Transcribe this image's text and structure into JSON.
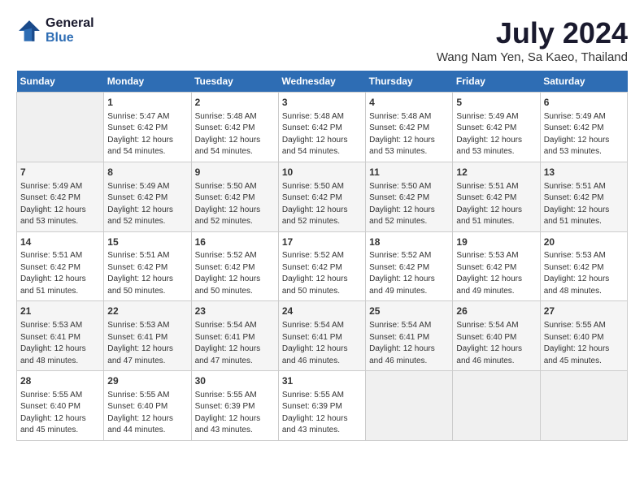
{
  "header": {
    "logo_line1": "General",
    "logo_line2": "Blue",
    "main_title": "July 2024",
    "subtitle": "Wang Nam Yen, Sa Kaeo, Thailand"
  },
  "weekdays": [
    "Sunday",
    "Monday",
    "Tuesday",
    "Wednesday",
    "Thursday",
    "Friday",
    "Saturday"
  ],
  "weeks": [
    [
      {
        "day": "",
        "sunrise": "",
        "sunset": "",
        "daylight": "",
        "empty": true
      },
      {
        "day": "1",
        "sunrise": "Sunrise: 5:47 AM",
        "sunset": "Sunset: 6:42 PM",
        "daylight": "Daylight: 12 hours and 54 minutes."
      },
      {
        "day": "2",
        "sunrise": "Sunrise: 5:48 AM",
        "sunset": "Sunset: 6:42 PM",
        "daylight": "Daylight: 12 hours and 54 minutes."
      },
      {
        "day": "3",
        "sunrise": "Sunrise: 5:48 AM",
        "sunset": "Sunset: 6:42 PM",
        "daylight": "Daylight: 12 hours and 54 minutes."
      },
      {
        "day": "4",
        "sunrise": "Sunrise: 5:48 AM",
        "sunset": "Sunset: 6:42 PM",
        "daylight": "Daylight: 12 hours and 53 minutes."
      },
      {
        "day": "5",
        "sunrise": "Sunrise: 5:49 AM",
        "sunset": "Sunset: 6:42 PM",
        "daylight": "Daylight: 12 hours and 53 minutes."
      },
      {
        "day": "6",
        "sunrise": "Sunrise: 5:49 AM",
        "sunset": "Sunset: 6:42 PM",
        "daylight": "Daylight: 12 hours and 53 minutes."
      }
    ],
    [
      {
        "day": "7",
        "sunrise": "Sunrise: 5:49 AM",
        "sunset": "Sunset: 6:42 PM",
        "daylight": "Daylight: 12 hours and 53 minutes."
      },
      {
        "day": "8",
        "sunrise": "Sunrise: 5:49 AM",
        "sunset": "Sunset: 6:42 PM",
        "daylight": "Daylight: 12 hours and 52 minutes."
      },
      {
        "day": "9",
        "sunrise": "Sunrise: 5:50 AM",
        "sunset": "Sunset: 6:42 PM",
        "daylight": "Daylight: 12 hours and 52 minutes."
      },
      {
        "day": "10",
        "sunrise": "Sunrise: 5:50 AM",
        "sunset": "Sunset: 6:42 PM",
        "daylight": "Daylight: 12 hours and 52 minutes."
      },
      {
        "day": "11",
        "sunrise": "Sunrise: 5:50 AM",
        "sunset": "Sunset: 6:42 PM",
        "daylight": "Daylight: 12 hours and 52 minutes."
      },
      {
        "day": "12",
        "sunrise": "Sunrise: 5:51 AM",
        "sunset": "Sunset: 6:42 PM",
        "daylight": "Daylight: 12 hours and 51 minutes."
      },
      {
        "day": "13",
        "sunrise": "Sunrise: 5:51 AM",
        "sunset": "Sunset: 6:42 PM",
        "daylight": "Daylight: 12 hours and 51 minutes."
      }
    ],
    [
      {
        "day": "14",
        "sunrise": "Sunrise: 5:51 AM",
        "sunset": "Sunset: 6:42 PM",
        "daylight": "Daylight: 12 hours and 51 minutes."
      },
      {
        "day": "15",
        "sunrise": "Sunrise: 5:51 AM",
        "sunset": "Sunset: 6:42 PM",
        "daylight": "Daylight: 12 hours and 50 minutes."
      },
      {
        "day": "16",
        "sunrise": "Sunrise: 5:52 AM",
        "sunset": "Sunset: 6:42 PM",
        "daylight": "Daylight: 12 hours and 50 minutes."
      },
      {
        "day": "17",
        "sunrise": "Sunrise: 5:52 AM",
        "sunset": "Sunset: 6:42 PM",
        "daylight": "Daylight: 12 hours and 50 minutes."
      },
      {
        "day": "18",
        "sunrise": "Sunrise: 5:52 AM",
        "sunset": "Sunset: 6:42 PM",
        "daylight": "Daylight: 12 hours and 49 minutes."
      },
      {
        "day": "19",
        "sunrise": "Sunrise: 5:53 AM",
        "sunset": "Sunset: 6:42 PM",
        "daylight": "Daylight: 12 hours and 49 minutes."
      },
      {
        "day": "20",
        "sunrise": "Sunrise: 5:53 AM",
        "sunset": "Sunset: 6:42 PM",
        "daylight": "Daylight: 12 hours and 48 minutes."
      }
    ],
    [
      {
        "day": "21",
        "sunrise": "Sunrise: 5:53 AM",
        "sunset": "Sunset: 6:41 PM",
        "daylight": "Daylight: 12 hours and 48 minutes."
      },
      {
        "day": "22",
        "sunrise": "Sunrise: 5:53 AM",
        "sunset": "Sunset: 6:41 PM",
        "daylight": "Daylight: 12 hours and 47 minutes."
      },
      {
        "day": "23",
        "sunrise": "Sunrise: 5:54 AM",
        "sunset": "Sunset: 6:41 PM",
        "daylight": "Daylight: 12 hours and 47 minutes."
      },
      {
        "day": "24",
        "sunrise": "Sunrise: 5:54 AM",
        "sunset": "Sunset: 6:41 PM",
        "daylight": "Daylight: 12 hours and 46 minutes."
      },
      {
        "day": "25",
        "sunrise": "Sunrise: 5:54 AM",
        "sunset": "Sunset: 6:41 PM",
        "daylight": "Daylight: 12 hours and 46 minutes."
      },
      {
        "day": "26",
        "sunrise": "Sunrise: 5:54 AM",
        "sunset": "Sunset: 6:40 PM",
        "daylight": "Daylight: 12 hours and 46 minutes."
      },
      {
        "day": "27",
        "sunrise": "Sunrise: 5:55 AM",
        "sunset": "Sunset: 6:40 PM",
        "daylight": "Daylight: 12 hours and 45 minutes."
      }
    ],
    [
      {
        "day": "28",
        "sunrise": "Sunrise: 5:55 AM",
        "sunset": "Sunset: 6:40 PM",
        "daylight": "Daylight: 12 hours and 45 minutes."
      },
      {
        "day": "29",
        "sunrise": "Sunrise: 5:55 AM",
        "sunset": "Sunset: 6:40 PM",
        "daylight": "Daylight: 12 hours and 44 minutes."
      },
      {
        "day": "30",
        "sunrise": "Sunrise: 5:55 AM",
        "sunset": "Sunset: 6:39 PM",
        "daylight": "Daylight: 12 hours and 43 minutes."
      },
      {
        "day": "31",
        "sunrise": "Sunrise: 5:55 AM",
        "sunset": "Sunset: 6:39 PM",
        "daylight": "Daylight: 12 hours and 43 minutes."
      },
      {
        "day": "",
        "sunrise": "",
        "sunset": "",
        "daylight": "",
        "empty": true
      },
      {
        "day": "",
        "sunrise": "",
        "sunset": "",
        "daylight": "",
        "empty": true
      },
      {
        "day": "",
        "sunrise": "",
        "sunset": "",
        "daylight": "",
        "empty": true
      }
    ]
  ]
}
